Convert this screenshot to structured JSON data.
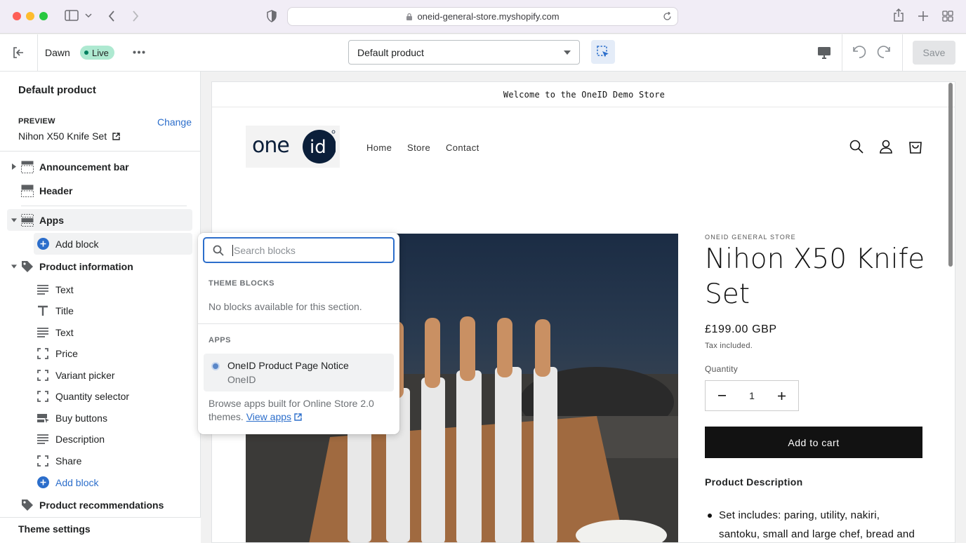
{
  "browser": {
    "url": "oneid-general-store.myshopify.com"
  },
  "toolbar": {
    "theme_name": "Dawn",
    "live_badge": "Live",
    "template_select": "Default product",
    "save_label": "Save"
  },
  "sidebar": {
    "title": "Default product",
    "preview_label": "PREVIEW",
    "change_label": "Change",
    "preview_product": "Nihon X50 Knife Set",
    "sections": {
      "announcement": "Announcement bar",
      "header": "Header",
      "apps": "Apps",
      "apps_add_block": "Add block",
      "product_info": "Product information",
      "product_info_add_block": "Add block",
      "product_recs": "Product recommendations"
    },
    "product_blocks": [
      {
        "label": "Text",
        "icon": "text-icon"
      },
      {
        "label": "Title",
        "icon": "title-icon"
      },
      {
        "label": "Text",
        "icon": "text-icon"
      },
      {
        "label": "Price",
        "icon": "block-dashed-icon"
      },
      {
        "label": "Variant picker",
        "icon": "block-dashed-icon"
      },
      {
        "label": "Quantity selector",
        "icon": "block-dashed-icon"
      },
      {
        "label": "Buy buttons",
        "icon": "buy-buttons-icon"
      },
      {
        "label": "Description",
        "icon": "text-icon"
      },
      {
        "label": "Share",
        "icon": "block-dashed-icon"
      }
    ],
    "theme_settings": "Theme settings"
  },
  "popup": {
    "search_placeholder": "Search blocks",
    "theme_blocks_heading": "THEME BLOCKS",
    "no_blocks": "No blocks available for this section.",
    "apps_heading": "APPS",
    "app_name": "OneID Product Page Notice",
    "app_vendor": "OneID",
    "browse_text": "Browse apps built for Online Store 2.0 themes.",
    "view_apps": "View apps"
  },
  "store": {
    "announcement": "Welcome to the OneID Demo Store",
    "logo_text": "oneid",
    "nav": [
      "Home",
      "Store",
      "Contact"
    ],
    "vendor": "ONEID GENERAL STORE",
    "product_title": "Nihon X50 Knife Set",
    "price": "£199.00 GBP",
    "tax_note": "Tax included.",
    "quantity_label": "Quantity",
    "quantity_value": "1",
    "add_to_cart": "Add to cart",
    "description_heading": "Product Description",
    "description_bullet": "Set includes: paring, utility, nakiri, santoku, small and large chef, bread and"
  },
  "colors": {
    "accent": "#2c6ecb",
    "live_badge": "#aee9d1",
    "cart_button": "#121212"
  }
}
